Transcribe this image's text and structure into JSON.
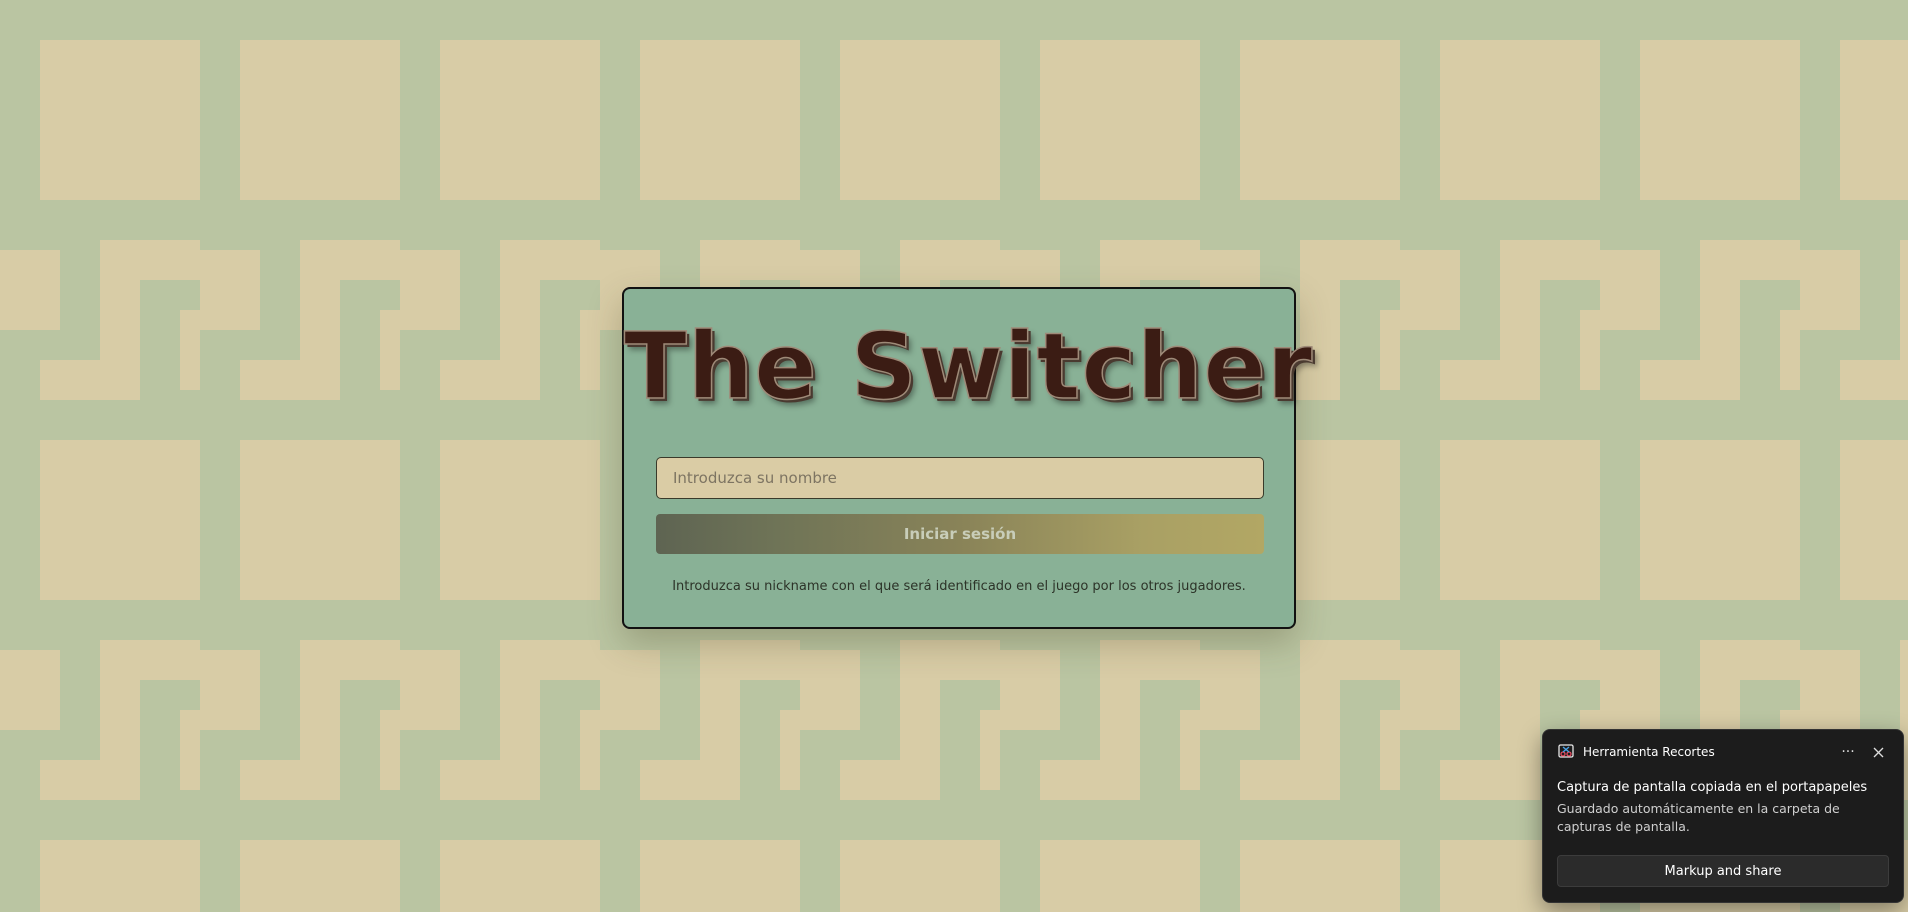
{
  "theme": {
    "background": "#bac5a2",
    "pattern": "#d8cca6",
    "card": "#89b196",
    "title_color": "#3b1c14"
  },
  "login": {
    "title": "The Switcher",
    "name_placeholder": "Introduzca su nombre",
    "name_value": "",
    "submit_label": "Iniciar sesión",
    "hint": "Introduzca su nickname con el que será identificado en el juego por los otros jugadores."
  },
  "notification": {
    "app_icon": "snipping-tool-icon",
    "app_name": "Herramienta Recortes",
    "more_icon": "more-icon",
    "close_icon": "close-icon",
    "title": "Captura de pantalla copiada en el portapapeles",
    "body": "Guardado automáticamente en la carpeta de capturas de pantalla.",
    "action_label": "Markup and share"
  }
}
